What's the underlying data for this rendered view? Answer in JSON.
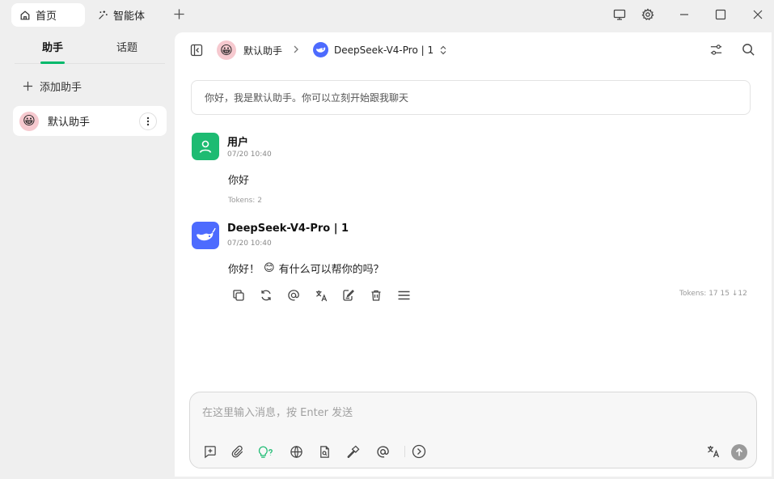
{
  "titlebar": {
    "tabs": [
      {
        "label": "首页",
        "icon": "home-icon",
        "active": true
      },
      {
        "label": "智能体",
        "icon": "sparkle-icon",
        "active": false
      }
    ],
    "new_tab_icon": "plus-icon",
    "window_controls": [
      "monitor-icon",
      "settings-icon",
      "minimize-icon",
      "maximize-icon",
      "close-icon"
    ]
  },
  "sidebar": {
    "tabs": [
      {
        "label": "助手",
        "active": true
      },
      {
        "label": "话题",
        "active": false
      }
    ],
    "add_label": "添加助手",
    "assistants": [
      {
        "name": "默认助手",
        "avatar": "😀",
        "selected": true
      }
    ]
  },
  "header": {
    "assistant_name": "默认助手",
    "model_name": "DeepSeek-V4-Pro | 1"
  },
  "chat": {
    "welcome_text": "你好，我是默认助手。你可以立刻开始跟我聊天",
    "messages": [
      {
        "role": "user",
        "name": "用户",
        "time": "07/20 10:40",
        "text": "你好",
        "tokens": "Tokens: 2"
      },
      {
        "role": "assistant",
        "name": "DeepSeek-V4-Pro | 1",
        "time": "07/20 10:40",
        "text_before": "你好！",
        "emoji": "😊",
        "text_after": "有什么可以帮你的吗？",
        "tokens": "Tokens: 17 15 ↓12"
      }
    ],
    "message_actions": [
      "copy-icon",
      "regenerate-icon",
      "mention-icon",
      "translate-icon",
      "edit-icon",
      "delete-icon",
      "menu-icon"
    ]
  },
  "input": {
    "placeholder": "在这里输入消息，按 Enter 发送",
    "tools": [
      "new-topic-icon",
      "attachment-icon",
      "thinking-icon",
      "web-search-icon",
      "knowledge-icon",
      "mcp-tools-icon",
      "mention-model-icon",
      "expand-icon"
    ],
    "right_tools": [
      "translate-icon",
      "send-icon"
    ]
  },
  "colors": {
    "accent": "#00b96b",
    "user_avatar_bg": "#1dbb72",
    "deepseek_blue": "#4d6bfe"
  }
}
